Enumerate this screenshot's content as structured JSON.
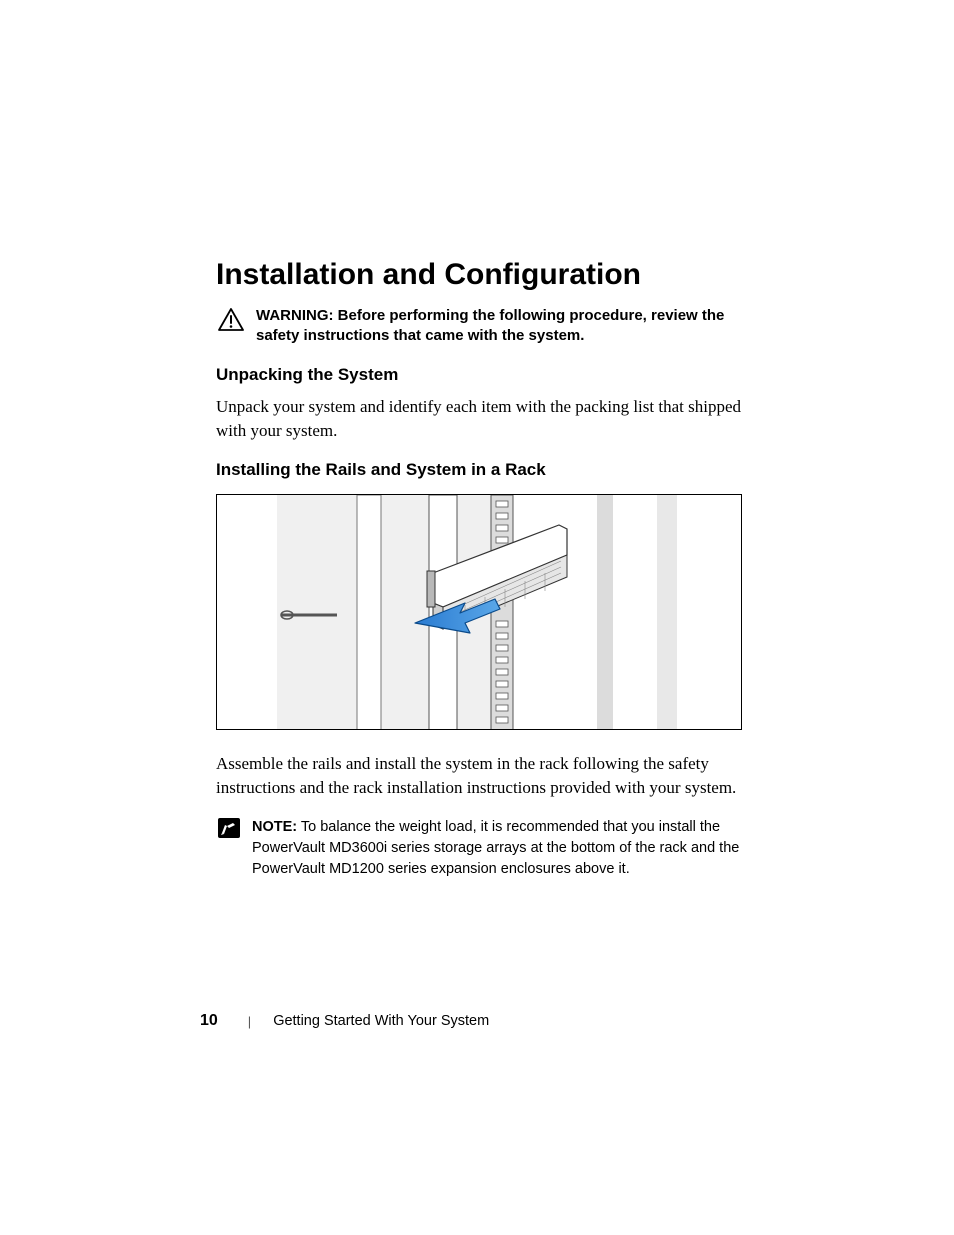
{
  "heading": "Installation and Configuration",
  "warning": {
    "label": "WARNING:",
    "text": " Before performing the following procedure, review the safety instructions that came with the system."
  },
  "section1": {
    "title": "Unpacking the System",
    "body": "Unpack your system and identify each item with the packing list that shipped with your system."
  },
  "section2": {
    "title": "Installing the Rails and System in a Rack",
    "body": "Assemble the rails and install the system in the rack following the safety instructions and the rack installation instructions provided with your system."
  },
  "note": {
    "label": "NOTE:",
    "text": " To balance the weight load, it is recommended that you install the PowerVault MD3600i series storage arrays at the bottom of the rack and the PowerVault MD1200 series expansion enclosures above it."
  },
  "footer": {
    "page_number": "10",
    "doc_title": "Getting Started With Your System"
  }
}
